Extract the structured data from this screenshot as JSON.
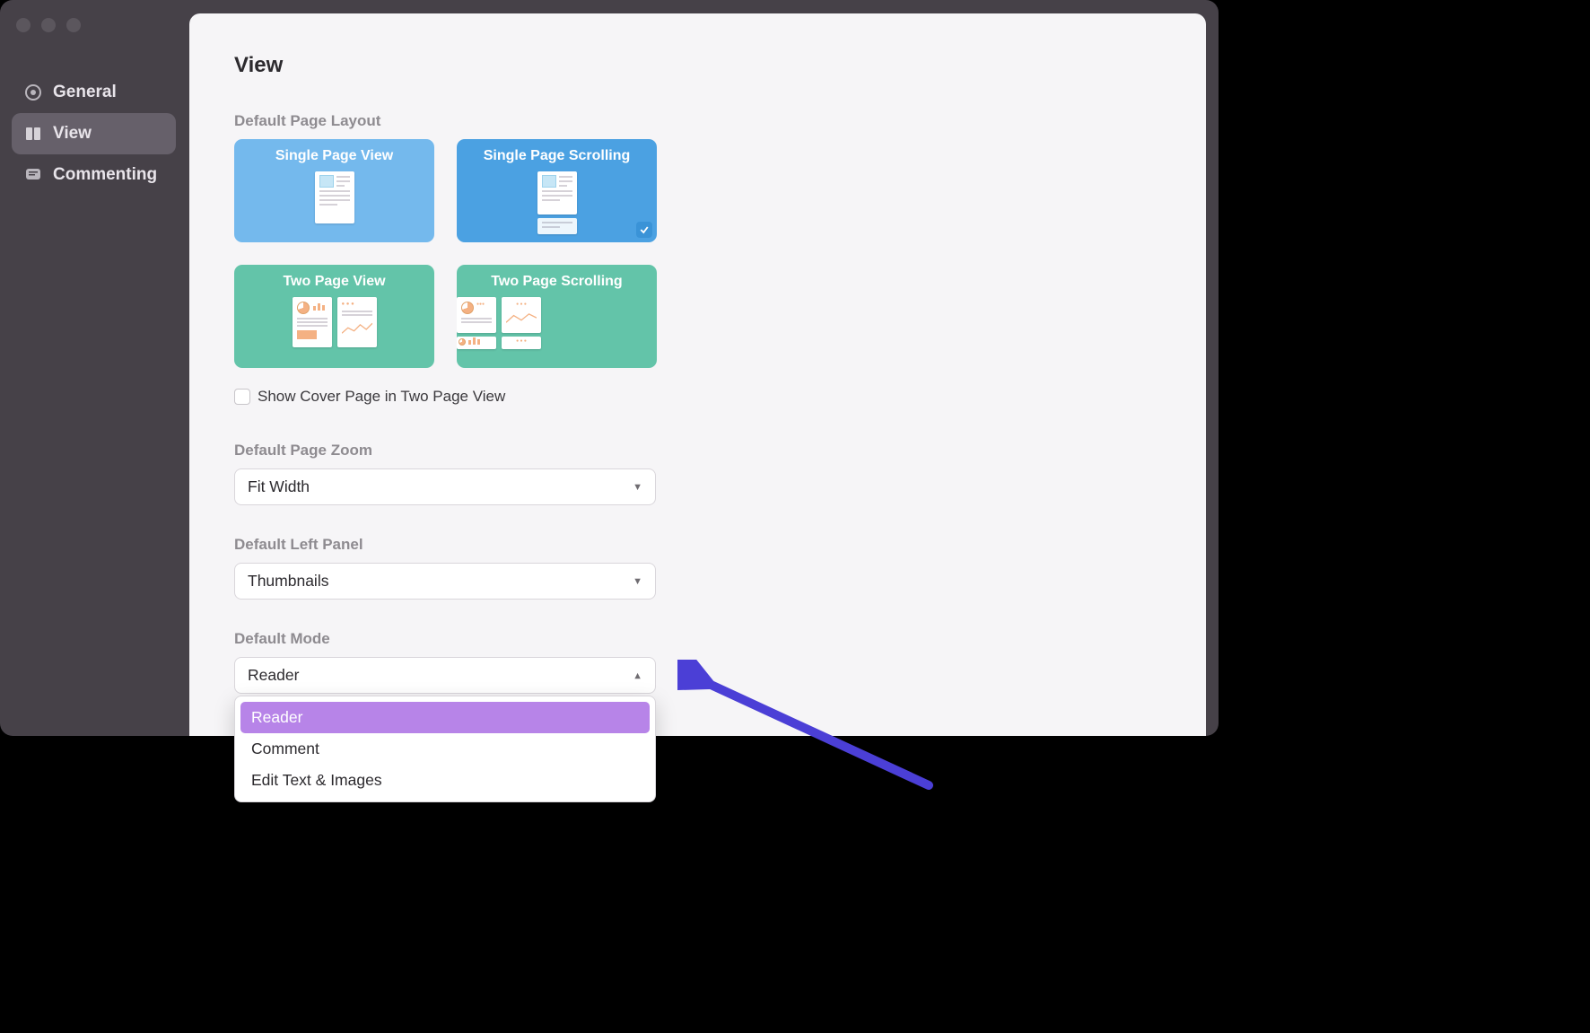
{
  "sidebar": {
    "items": [
      {
        "label": "General"
      },
      {
        "label": "View"
      },
      {
        "label": "Commenting"
      }
    ]
  },
  "page": {
    "title": "View"
  },
  "layout": {
    "section_label": "Default Page Layout",
    "options": [
      {
        "label": "Single Page View"
      },
      {
        "label": "Single Page Scrolling"
      },
      {
        "label": "Two Page View"
      },
      {
        "label": "Two Page Scrolling"
      }
    ],
    "show_cover_label": "Show Cover Page in Two Page View"
  },
  "zoom": {
    "section_label": "Default Page Zoom",
    "value": "Fit Width"
  },
  "left_panel": {
    "section_label": "Default Left Panel",
    "value": "Thumbnails"
  },
  "mode": {
    "section_label": "Default Mode",
    "value": "Reader",
    "options": [
      "Reader",
      "Comment",
      "Edit Text & Images"
    ]
  }
}
